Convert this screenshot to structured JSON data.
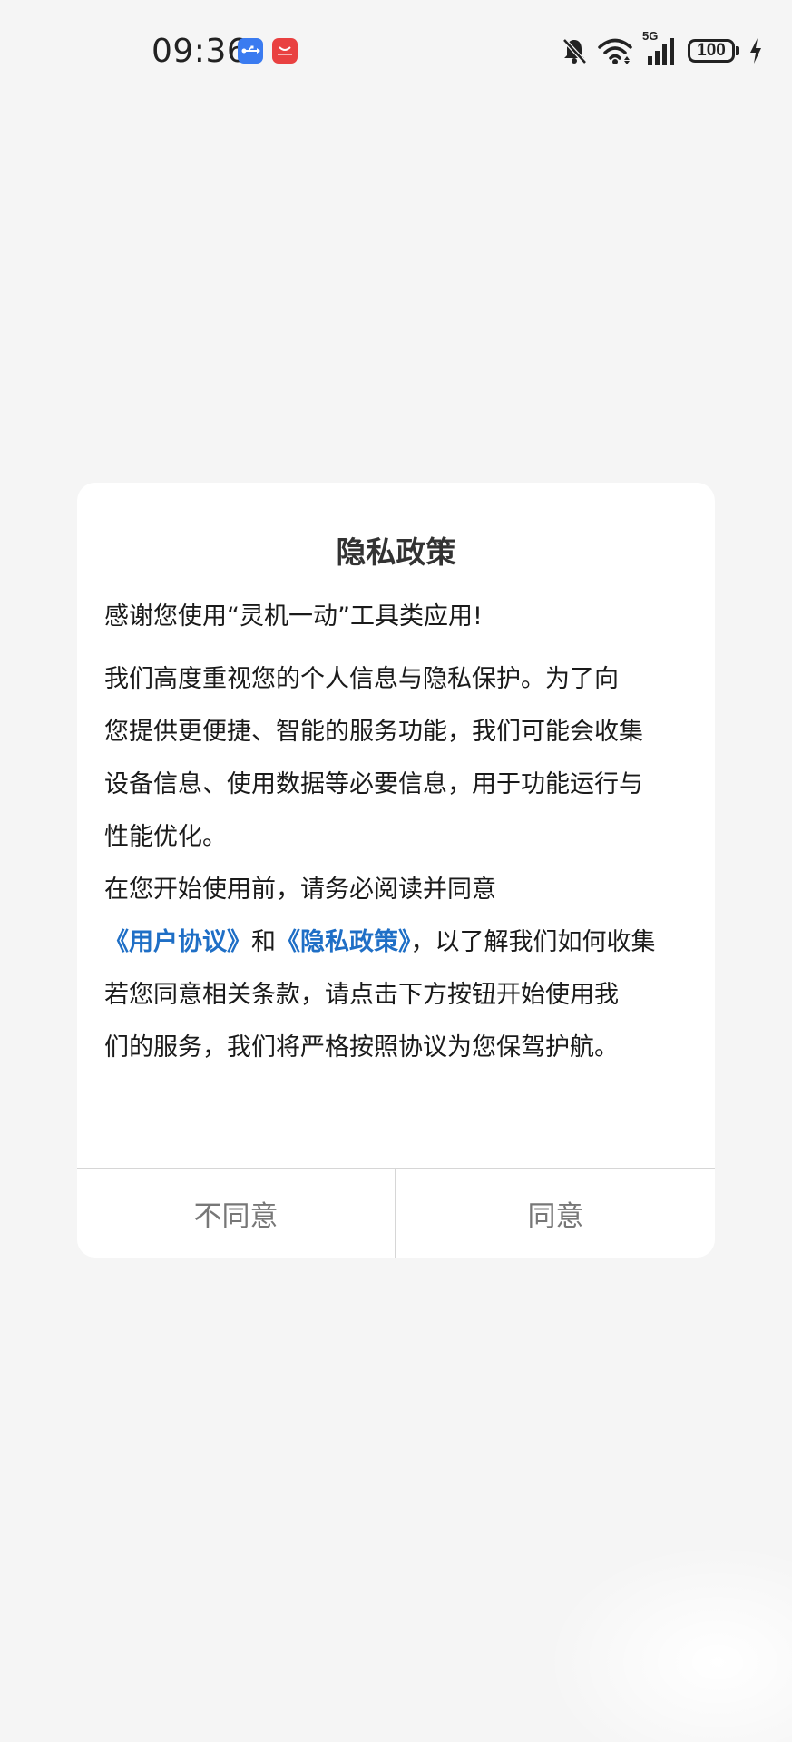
{
  "status_bar": {
    "time": "09:36",
    "signal_label": "5G",
    "battery": "100"
  },
  "dialog": {
    "title": "隐私政策",
    "greeting": "感谢您使用“灵机一动”工具类应用!",
    "paragraph1": [
      " 我们高度重视您的个人信息与隐私保护。为了向",
      "您提供更便捷、智能的服务功能，我们可能会收集",
      "设备信息、使用数据等必要信息，用于功能运行与",
      "性能优化。"
    ],
    "paragraph2_line1": " 在您开始使用前，请务必阅读并同意",
    "user_agreement_link": "《用户协议》",
    "conjunction": "和",
    "privacy_policy_link": "《隐私政策》",
    "paragraph2_tail": "，以了解我们如何收集",
    "paragraph3": [
      " 若您同意相关条款，请点击下方按钮开始使用我",
      "们的服务，我们将严格按照协议为您保驾护航。"
    ],
    "disagree_label": "不同意",
    "agree_label": "同意"
  }
}
